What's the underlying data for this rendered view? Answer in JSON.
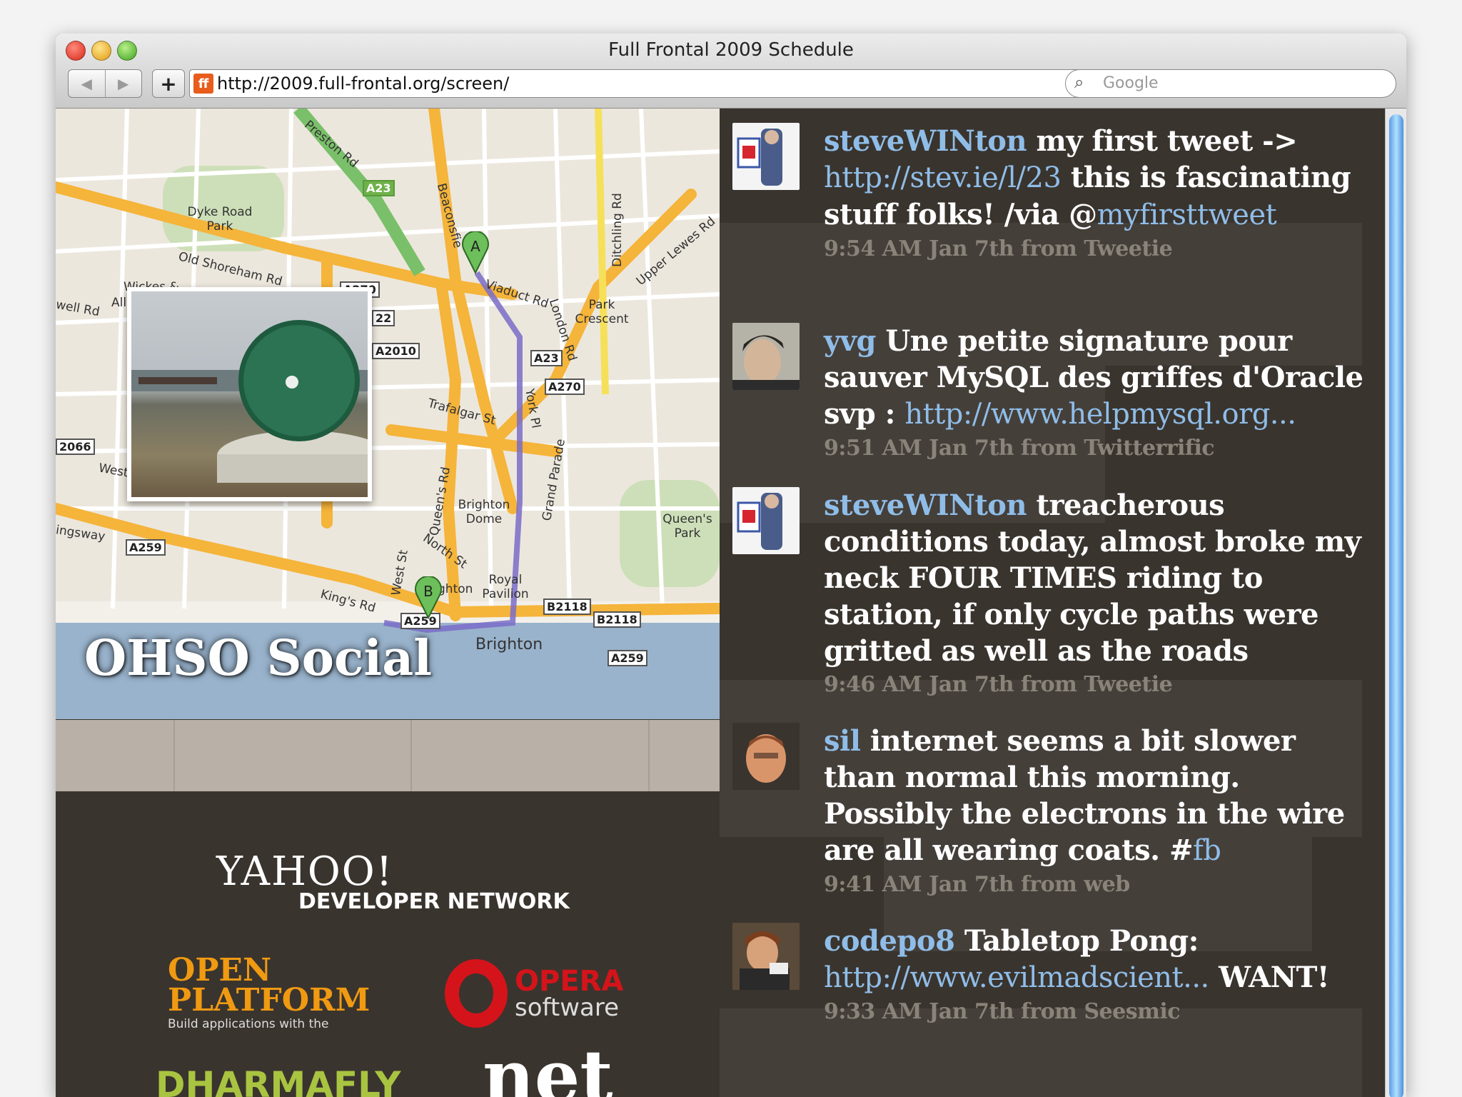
{
  "window": {
    "title": "Full Frontal 2009 Schedule"
  },
  "toolbar": {
    "back_icon": "back-arrow-icon",
    "forward_icon": "forward-arrow-icon",
    "add_label": "+",
    "favicon": "ff",
    "url": "http://2009.full-frontal.org/screen/",
    "reload_icon": "reload-icon",
    "search_placeholder": "Google"
  },
  "map": {
    "venue_name": "OHSO Social",
    "markers": [
      "A",
      "B"
    ],
    "labels": {
      "preston_rd": "Preston Rd",
      "a23_top": "A23",
      "dyke_road_park": "Dyke Road Park",
      "old_shoreham_rd": "Old Shoreham Rd",
      "wickes": "Wickes &",
      "all": "All",
      "well_rd": "well Rd",
      "beaconsfield": "Beaconsfie",
      "ditchling_rd": "Ditchling Rd",
      "upper_lewes_rd": "Upper Lewes Rd",
      "viaduct_rd": "Viaduct Rd",
      "park_crescent": "Park Crescent",
      "london_rd": "London Rd",
      "a270_top": "A270",
      "a22": "22",
      "a2010": "A2010",
      "a23_mid": "A23",
      "a270_mid": "A270",
      "trafalgar_st": "Trafalgar St",
      "york_pl": "York Pl",
      "a2066": "2066",
      "west": "West",
      "queens_rd": "Queen's Rd",
      "grand_parade": "Grand Parade",
      "brighton_dome": "Brighton Dome",
      "queens_park": "Queen's Park",
      "ingsway": "ingsway",
      "a259_left": "A259",
      "north_st": "North St",
      "west_st": "West St",
      "royal_pavilion": "Royal Pavilion",
      "ghton": "ghton",
      "kings_rd": "King's Rd",
      "b2118_a": "B2118",
      "b2118_b": "B2118",
      "a259_marker": "A259",
      "brighton": "Brighton",
      "a259_right": "A259"
    }
  },
  "sponsors": {
    "yahoo_line1": "YAHOO!",
    "yahoo_line2": "DEVELOPER NETWORK",
    "open_platform_line1": "OPEN",
    "open_platform_line2": "PLATFORM",
    "open_platform_tagline": "Build applications with the",
    "opera_line1": "OPERA",
    "opera_line2": "software",
    "dharmafly": "DHARMAFLY",
    "net": "net"
  },
  "tweets": [
    {
      "user": "steveWINton",
      "text": " my first tweet -> ",
      "link": "http://stev.ie/l/23",
      "text2": " this is fascinating stuff folks! /via @",
      "link2": "myfirsttweet",
      "meta": "9:54 AM Jan 7th from Tweetie"
    },
    {
      "user": "yvg",
      "text": " Une petite signature pour sauver MySQL des griffes d'Oracle svp : ",
      "link": "http://www.helpmysql.org...",
      "meta": "9:51 AM Jan 7th from Twitterrific"
    },
    {
      "user": "steveWINton",
      "text": " treacherous conditions today, almost broke my neck FOUR TIMES riding to station, if only cycle paths were gritted as well as the roads",
      "meta": "9:46 AM Jan 7th from Tweetie"
    },
    {
      "user": "sil",
      "text": " internet seems a bit slower than normal this morning. Possibly the electrons in the wire are all wearing coats. #",
      "link": "fb",
      "meta": "9:41 AM Jan 7th from web"
    },
    {
      "user": "codepo8",
      "text": " Tabletop Pong: ",
      "link": "http://www.evilmadscient...",
      "text2": " WANT!",
      "meta": "9:33 AM Jan 7th from Seesmic"
    }
  ]
}
